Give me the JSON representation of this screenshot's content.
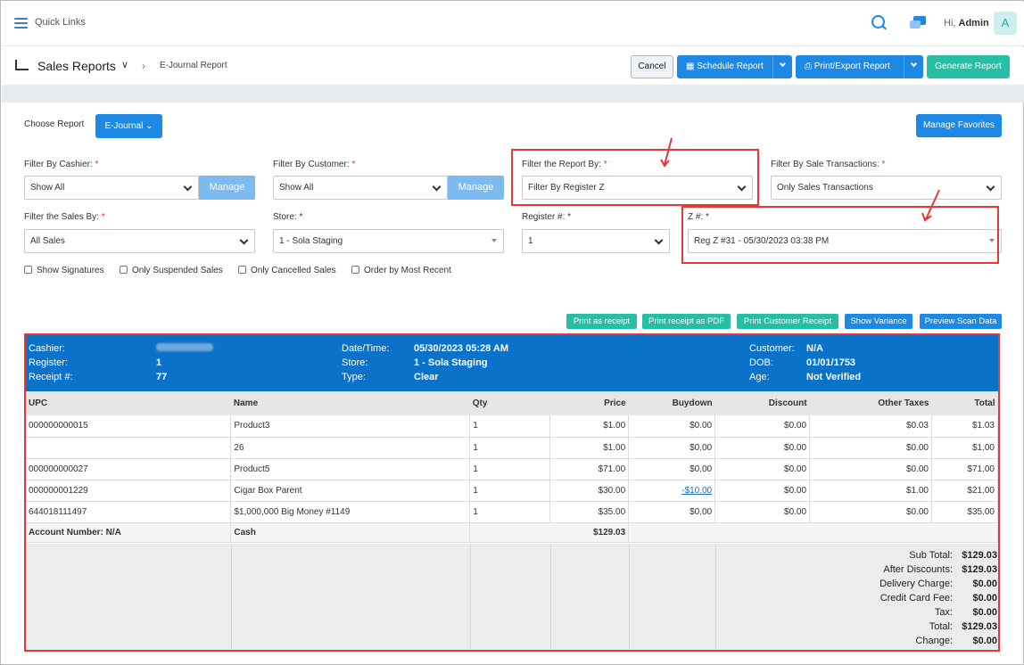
{
  "topbar": {
    "quick_links": "Quick Links",
    "greeting": "Hi,",
    "user": "Admin",
    "avatar": "A"
  },
  "header": {
    "title": "Sales Reports",
    "breadcrumb": "E-Journal Report",
    "cancel": "Cancel",
    "schedule": "Schedule Report",
    "print_export": "Print/Export Report",
    "generate": "Generate Report"
  },
  "filters": {
    "choose_report_label": "Choose Report",
    "choose_report_value": "E-Journal",
    "manage_favorites": "Manage Favorites",
    "cashier_label": "Filter By Cashier:",
    "cashier_value": "Show All",
    "customer_label": "Filter By Customer:",
    "customer_value": "Show All",
    "manage": "Manage",
    "report_by_label": "Filter the Report By:",
    "report_by_value": "Filter By Register Z",
    "sale_tx_label": "Filter By Sale Transactions:",
    "sale_tx_value": "Only Sales Transactions",
    "sales_by_label": "Filter the Sales By:",
    "sales_by_value": "All Sales",
    "store_label": "Store:",
    "store_value": "1 - Sola Staging",
    "register_label": "Register #:",
    "register_value": "1",
    "z_label": "Z #:",
    "z_value": "Reg Z #31 - 05/30/2023 03:38 PM",
    "checks": [
      "Show Signatures",
      "Only Suspended Sales",
      "Only Cancelled Sales",
      "Order by Most Recent"
    ]
  },
  "actions": [
    "Print as receipt",
    "Print receipt as PDF",
    "Print Customer Receipt",
    "Show Variance",
    "Preview Scan Data"
  ],
  "receipt": {
    "cashier_k": "Cashier:",
    "register_k": "Register:",
    "register_v": "1",
    "receipt_k": "Receipt #:",
    "receipt_v": "77",
    "date_k": "Date/Time:",
    "date_v": "05/30/2023 05:28 AM",
    "store_k": "Store:",
    "store_v": "1 - Sola Staging",
    "type_k": "Type:",
    "type_v": "Clear",
    "customer_k": "Customer:",
    "customer_v": "N/A",
    "dob_k": "DOB:",
    "dob_v": "01/01/1753",
    "age_k": "Age:",
    "age_v": "Not Verified"
  },
  "table": {
    "headers": [
      "UPC",
      "Name",
      "Qty",
      "Price",
      "Buydown",
      "Discount",
      "Other Taxes",
      "Total"
    ],
    "rows": [
      [
        "000000000015",
        "Product3",
        "1",
        "$1.00",
        "$0.00",
        "$0.00",
        "$0.03",
        "$1.03"
      ],
      [
        "",
        "26",
        "1",
        "$1.00",
        "$0.00",
        "$0.00",
        "$0.00",
        "$1.00"
      ],
      [
        "000000000027",
        "Product5",
        "1",
        "$71.00",
        "$0.00",
        "$0.00",
        "$0.00",
        "$71.00"
      ],
      [
        "000000001229",
        "Cigar Box Parent",
        "1",
        "$30.00",
        "-$10.00",
        "$0.00",
        "$1.00",
        "$21.00"
      ],
      [
        "644018111497",
        "$1,000,000 Big Money #1149",
        "1",
        "$35.00",
        "$0.00",
        "$0.00",
        "$0.00",
        "$35.00"
      ]
    ],
    "account": "Account Number: N/A",
    "tender": "Cash",
    "tender_amount": "$129.03"
  },
  "totals": [
    [
      "Sub Total:",
      "$129.03"
    ],
    [
      "After Discounts:",
      "$129.03"
    ],
    [
      "Delivery Charge:",
      "$0.00"
    ],
    [
      "Credit Card Fee:",
      "$0.00"
    ],
    [
      "Tax:",
      "$0.00"
    ],
    [
      "Total:",
      "$129.03"
    ],
    [
      "Change:",
      "$0.00"
    ]
  ],
  "colors": {
    "primary": "#1e88e5",
    "teal": "#26bfa5",
    "receipt_header": "#0a73c9",
    "highlight": "#e53935"
  }
}
